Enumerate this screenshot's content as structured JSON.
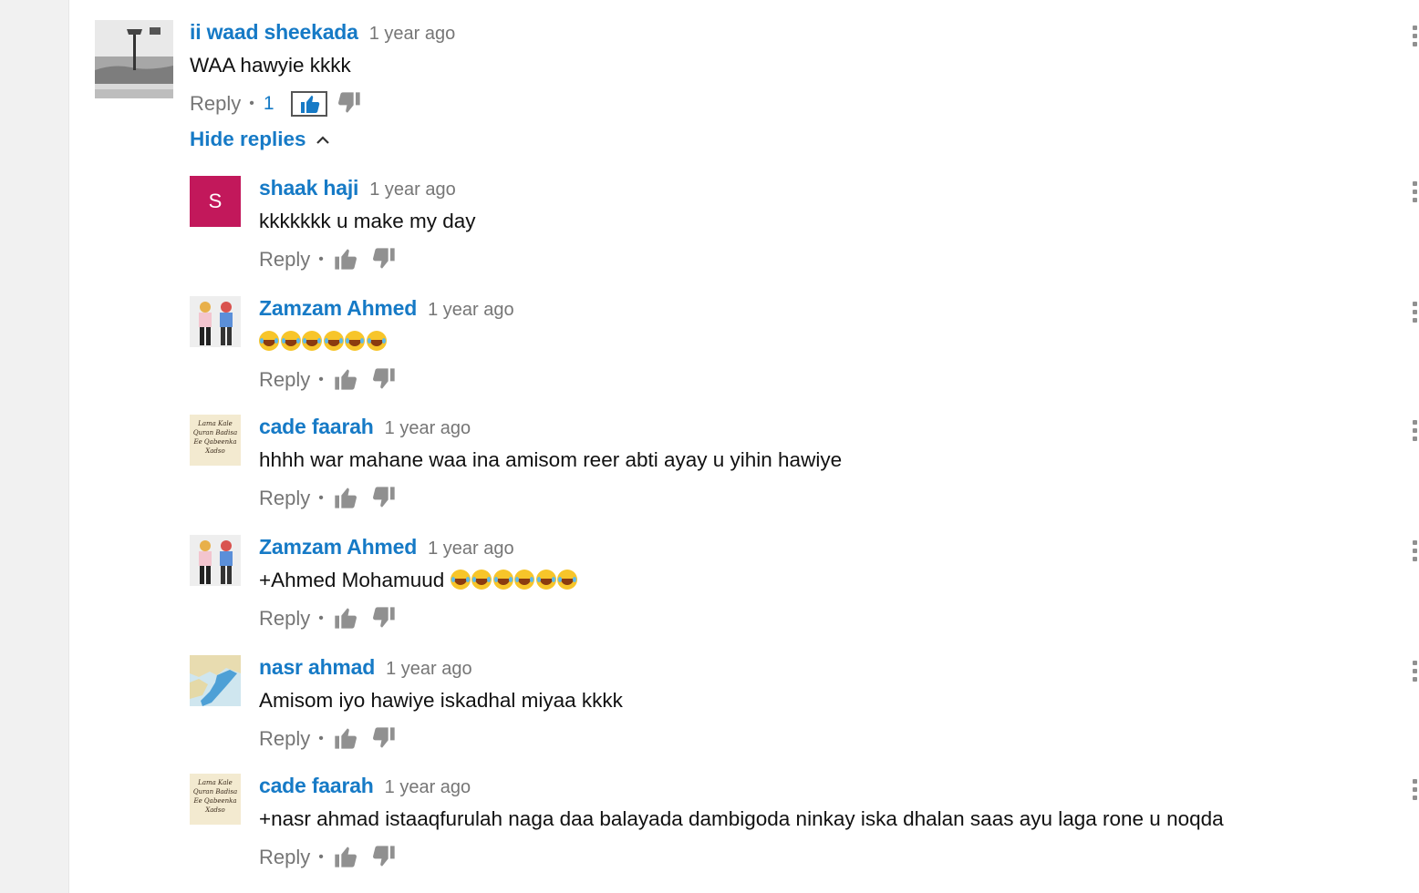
{
  "top_comment": {
    "author": "ii waad sheekada",
    "time": "1 year ago",
    "text": "WAA hawyie kkkk",
    "reply_label": "Reply",
    "separator": "•",
    "like_count": "1",
    "hide_replies_label": "Hide replies"
  },
  "replies": [
    {
      "author": "shaak haji",
      "time": "1 year ago",
      "text": "kkkkkkk u make my day",
      "reply_label": "Reply",
      "separator": "•",
      "avatar_letter": "S",
      "avatar_color": "#c2185b"
    },
    {
      "author": "Zamzam Ahmed",
      "time": "1 year ago",
      "text": "",
      "emoji_count": 6,
      "reply_label": "Reply",
      "separator": "•"
    },
    {
      "author": "cade faarah",
      "time": "1 year ago",
      "text": "hhhh war mahane waa ina amisom reer abti ayay u yihin hawiye",
      "reply_label": "Reply",
      "separator": "•"
    },
    {
      "author": "Zamzam Ahmed",
      "time": "1 year ago",
      "text": "+Ahmed Mohamuud",
      "emoji_count": 6,
      "reply_label": "Reply",
      "separator": "•"
    },
    {
      "author": "nasr ahmad",
      "time": "1 year ago",
      "text": "Amisom iyo hawiye iskadhal miyaa kkkk",
      "reply_label": "Reply",
      "separator": "•"
    },
    {
      "author": "cade faarah",
      "time": "1 year ago",
      "text": "+nasr ahmad istaaqfurulah naga daa balayada dambigoda ninkay iska dhalan saas ayu laga rone u noqda",
      "reply_label": "Reply",
      "separator": "•"
    }
  ],
  "avatar_book_text": "Lama Kale Quran Badisa Ee Qabeenka Xadso",
  "colors": {
    "link": "#167ac6",
    "meta": "#767676",
    "like_active": "#167ac6",
    "icon": "#909090"
  }
}
